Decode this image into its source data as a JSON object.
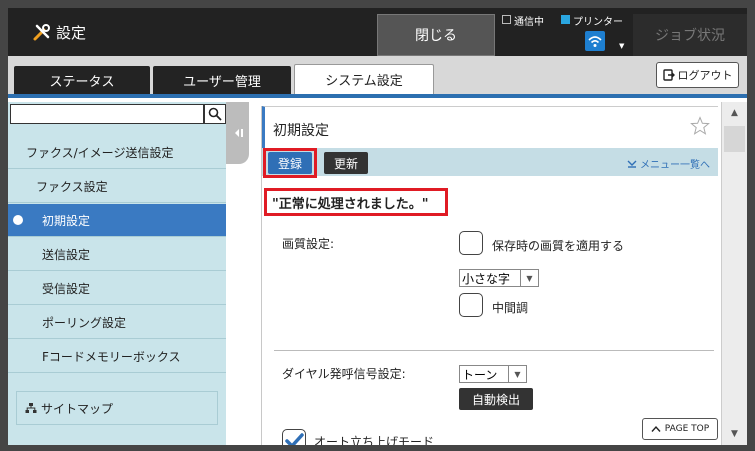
{
  "header": {
    "title": "設定",
    "close_label": "閉じる",
    "comm_label": "通信中",
    "printer_label": "プリンター",
    "job_status_label": "ジョブ状況"
  },
  "tabs": [
    {
      "label": "ステータス",
      "active": false
    },
    {
      "label": "ユーザー管理",
      "active": false
    },
    {
      "label": "システム設定",
      "active": true
    }
  ],
  "logout_label": "ログアウト",
  "sidebar": {
    "search_value": "",
    "items": [
      {
        "label": "ファクス/イメージ送信設定",
        "active": false
      },
      {
        "label": "ファクス設定",
        "active": false
      },
      {
        "label": "初期設定",
        "active": true
      },
      {
        "label": "送信設定",
        "active": false
      },
      {
        "label": "受信設定",
        "active": false
      },
      {
        "label": "ポーリング設定",
        "active": false
      },
      {
        "label": "Fコードメモリーボックス",
        "active": false
      }
    ],
    "sitemap_label": "サイトマップ"
  },
  "content": {
    "title": "初期設定",
    "register_label": "登録",
    "update_label": "更新",
    "menu_link": "メニュー一覧へ",
    "message": "\"正常に処理されました。\"",
    "image_quality_label": "画質設定:",
    "apply_quality_label": "保存時の画質を適用する",
    "quality_select_value": "小さな字",
    "halftone_label": "中間調",
    "dial_label": "ダイヤル発呼信号設定:",
    "dial_select_value": "トーン",
    "autodetect_label": "自動検出",
    "pagetop_label": "PAGE TOP",
    "autoboot_label": "オート立ち上げモード"
  },
  "colors": {
    "accent": "#3a7ac2",
    "highlight": "#e01b24",
    "sidebar_bg": "#c9e4ea"
  }
}
